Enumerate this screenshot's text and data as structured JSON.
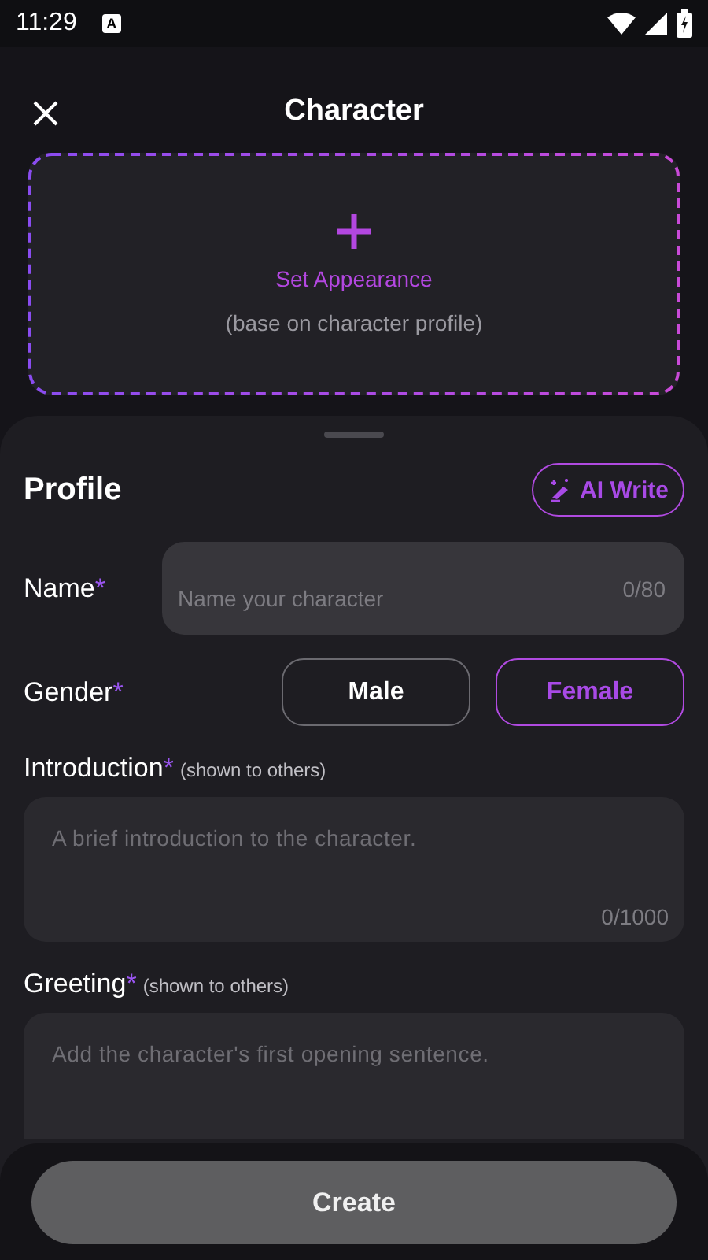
{
  "status_bar": {
    "time": "11:29",
    "notification": "A"
  },
  "header": {
    "title": "Character"
  },
  "appearance": {
    "label": "Set Appearance",
    "hint": "(base on character profile)"
  },
  "profile": {
    "title": "Profile",
    "ai_button": "AI Write"
  },
  "name_field": {
    "label": "Name",
    "required_mark": "*",
    "placeholder": "Name your character",
    "counter": "0/80"
  },
  "gender": {
    "label": "Gender",
    "required_mark": "*",
    "options": [
      {
        "label": "Male",
        "selected": false
      },
      {
        "label": "Female",
        "selected": true
      }
    ]
  },
  "introduction": {
    "label": "Introduction",
    "required_mark": "*",
    "note": "(shown to others)",
    "placeholder": "A brief introduction to the character.",
    "counter": "0/1000"
  },
  "greeting": {
    "label": "Greeting",
    "required_mark": "*",
    "note": "(shown to others)",
    "placeholder": "Add the character's first opening sentence."
  },
  "create_button": {
    "label": "Create"
  }
}
